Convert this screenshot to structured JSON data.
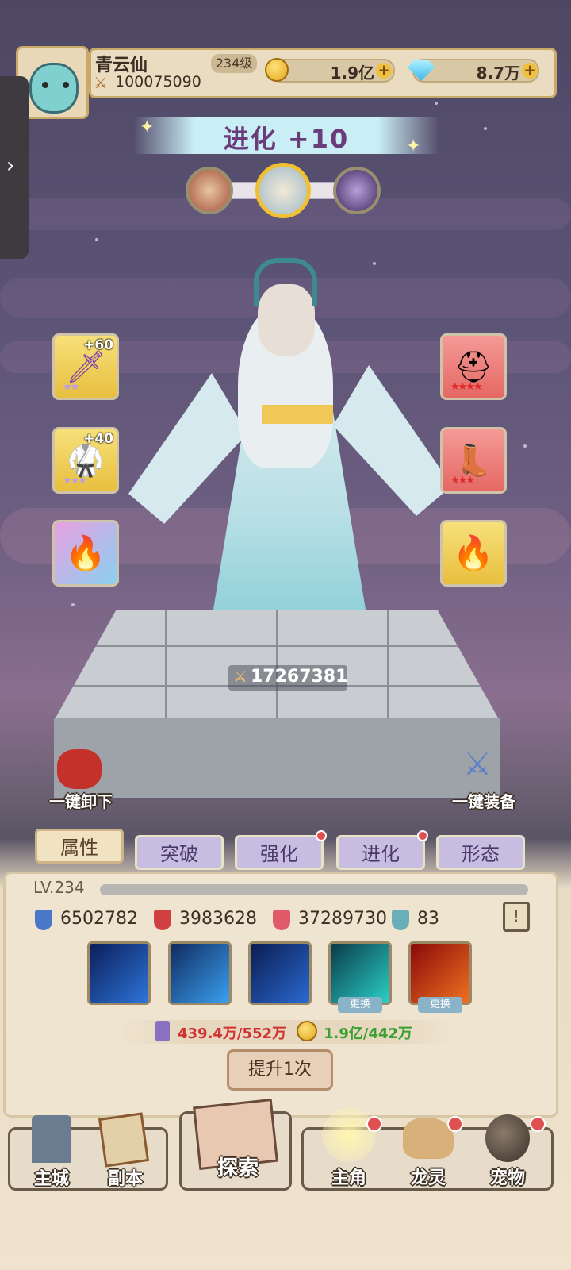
{
  "player": {
    "name": "青云仙",
    "level": "234级",
    "power": "100075090"
  },
  "resources": {
    "gold": "1.9亿",
    "gems": "8.7万"
  },
  "evolution": {
    "title": "进化 +10"
  },
  "equipment": {
    "left": [
      {
        "plus": "+60"
      },
      {
        "plus": "+40"
      },
      {
        "plus": ""
      }
    ],
    "right": [
      {
        "plus": ""
      },
      {
        "plus": ""
      },
      {
        "plus": ""
      }
    ]
  },
  "character": {
    "power": "17267381"
  },
  "quick": {
    "unequip": "一键卸下",
    "equip": "一键装备"
  },
  "tabs": [
    "属性",
    "突破",
    "强化",
    "进化",
    "形态"
  ],
  "panel": {
    "level": "LV.234",
    "stats": [
      "6502782",
      "3983628",
      "37289730",
      "83"
    ],
    "swap_label": "更换",
    "cost_material": "439.4万/552万",
    "cost_gold": "1.9亿/442万",
    "upgrade": "提升1次"
  },
  "nav": {
    "city": "主城",
    "dungeon": "副本",
    "explore": "探索",
    "hero": "主角",
    "dragon": "龙灵",
    "pet": "宠物"
  },
  "colors": {
    "accent": "#e05050",
    "cost_red": "#d03030",
    "cost_green": "#3aa030",
    "tab_active": "#f1e2c2",
    "tab_inactive": "#c7bde0"
  }
}
